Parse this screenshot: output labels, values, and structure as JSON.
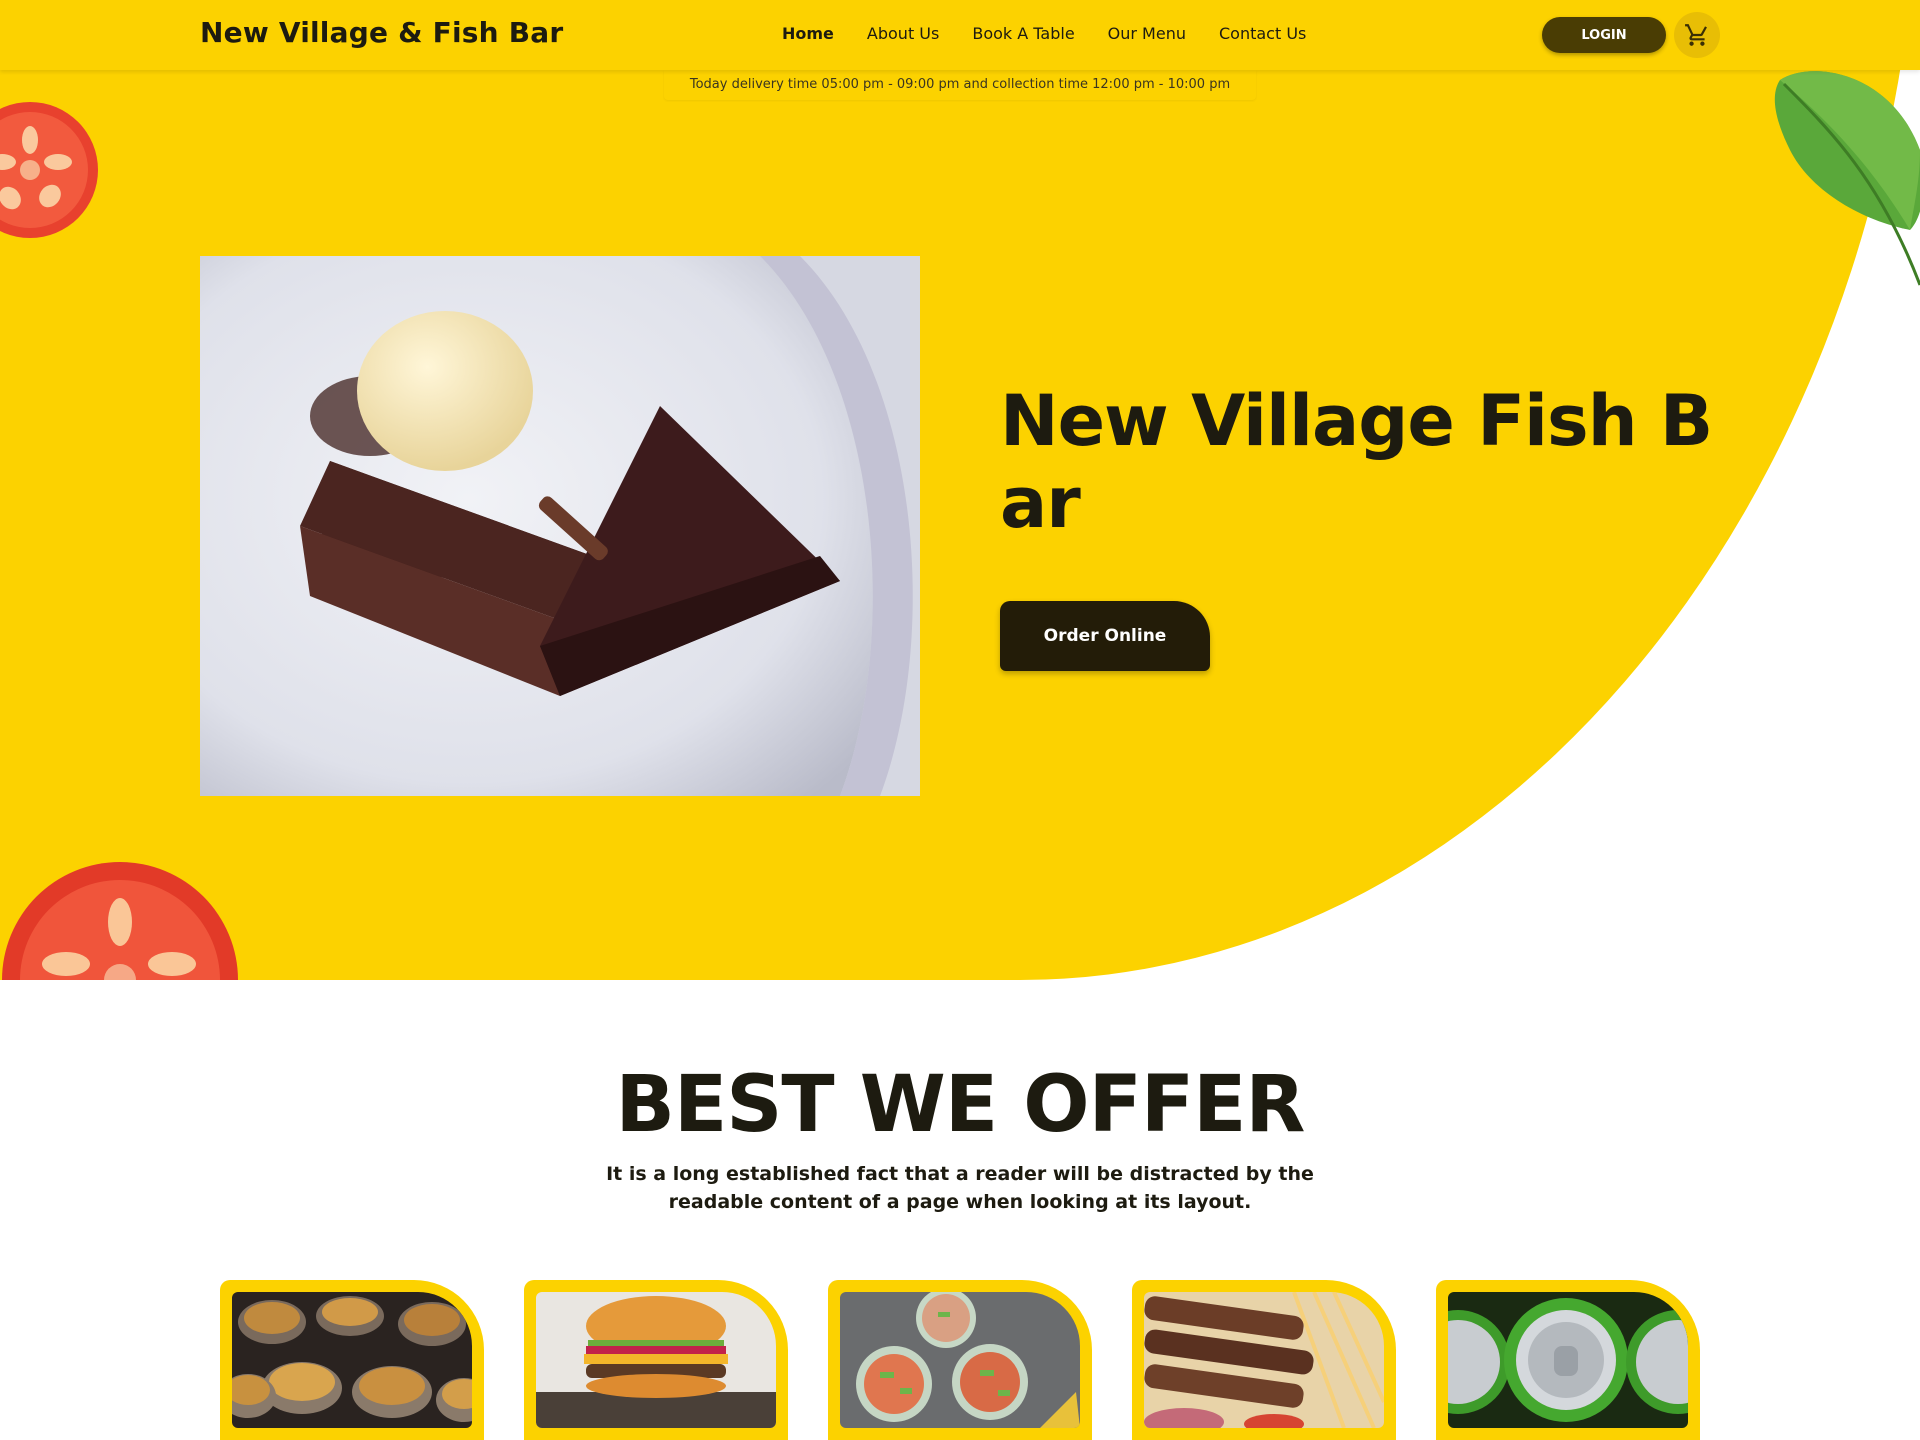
{
  "header": {
    "logo": "New Village & Fish Bar",
    "nav": [
      {
        "label": "Home",
        "active": true
      },
      {
        "label": "About Us",
        "active": false
      },
      {
        "label": "Book A Table",
        "active": false
      },
      {
        "label": "Our Menu",
        "active": false
      },
      {
        "label": "Contact Us",
        "active": false
      }
    ],
    "login_label": "LOGIN",
    "cart_icon": "cart-icon",
    "delivery_notice": "Today delivery time 05:00 pm - 09:00 pm and collection time 12:00 pm - 10:00 pm"
  },
  "hero": {
    "title": "New Village Fish Bar",
    "order_button": "Order Online",
    "image": "chocolate-cake-with-ice-cream"
  },
  "offer": {
    "title": "BEST WE OFFER",
    "description": "It is a long established fact that a reader will be distracted by the readable content of a page when looking at its layout.",
    "cards": [
      {
        "image": "pies"
      },
      {
        "image": "burger"
      },
      {
        "image": "salad-cups"
      },
      {
        "image": "kebab-skewers"
      },
      {
        "image": "soda-cans"
      }
    ]
  },
  "colors": {
    "brand_yellow": "#fcd200",
    "dark": "#1d1b10",
    "login_bg": "#4a3d04",
    "order_bg": "#231c08"
  }
}
